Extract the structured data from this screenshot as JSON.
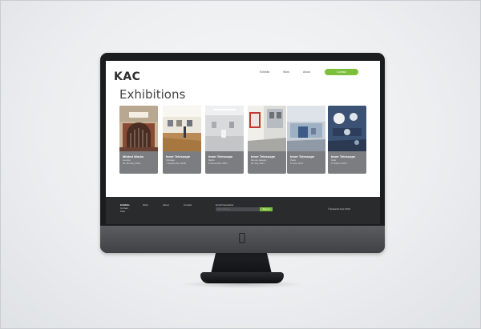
{
  "site": {
    "logo": "KAC",
    "nav": {
      "items": [
        "Exhibits",
        "Work",
        "About"
      ],
      "cta": "Contact"
    },
    "page_title": "Exhibitions"
  },
  "cards": [
    {
      "title": "Minted Works",
      "place": "London",
      "date": "25 January 2016"
    },
    {
      "title": "Inner Telescope",
      "place": "Chicago",
      "date": "7 September 2018"
    },
    {
      "title": "Inner Telescope",
      "place": "Berlin",
      "date": "8 November 2017"
    },
    {
      "title": "Inner Telescope",
      "place": "Rio de Janeiro",
      "date": "30 July 2017"
    },
    {
      "title": "Inner Telescope",
      "place": "Paris",
      "date": "8 June 2017"
    },
    {
      "title": "Inner Telescope",
      "place": "Oslo",
      "date": "13 March 2017"
    }
  ],
  "footer": {
    "exhibits_group": [
      "Exhibits",
      "Current",
      "Past"
    ],
    "links": [
      "Work",
      "About",
      "Contact"
    ],
    "newsletter_label": "Email Newsletter",
    "newsletter_placeholder": "Email address",
    "newsletter_button": "Sign up",
    "copyright": "© Eduardo Kac 2019"
  },
  "colors": {
    "accent": "#7bbf3a",
    "card_info": "#7c7d80",
    "footer": "#2a2b2d"
  }
}
